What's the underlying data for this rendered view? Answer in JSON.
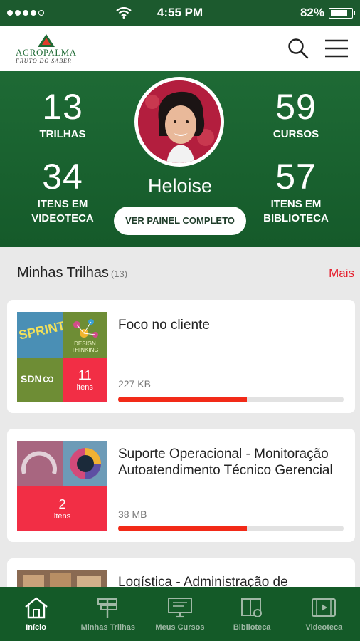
{
  "status_bar": {
    "time": "4:55 PM",
    "battery": "82%",
    "battery_level": 0.82
  },
  "header": {
    "logo_name": "AGROPALMA",
    "logo_tagline": "FRUTO DO SABER",
    "search_icon": "search-icon",
    "menu_icon": "hamburger-menu-icon"
  },
  "profile": {
    "name": "Heloise",
    "button_label": "VER PAINEL COMPLETO",
    "stats": {
      "trilhas": {
        "value": "13",
        "label": "TRILHAS"
      },
      "cursos": {
        "value": "59",
        "label": "CURSOS"
      },
      "videoteca": {
        "value": "34",
        "label_line1": "ITENS EM",
        "label_line2": "VIDEOTECA"
      },
      "biblioteca": {
        "value": "57",
        "label_line1": "ITENS EM",
        "label_line2": "BIBLIOTECA"
      }
    }
  },
  "section": {
    "title": "Minhas Trilhas",
    "count": "(13)",
    "more_label": "Mais"
  },
  "trails": [
    {
      "title": "Foco no cliente",
      "size": "227 KB",
      "items_count": "11",
      "items_label": "itens",
      "progress": 0.57,
      "thumb_text_1": "SPRINT",
      "thumb_text_2": "DESIGN THINKING",
      "thumb_text_3": "SDN"
    },
    {
      "title": "Suporte Operacional - Monitoração Autoatendimento Técnico Gerencial",
      "size": "38 MB",
      "items_count": "2",
      "items_label": "itens",
      "progress": 0.57
    },
    {
      "title": "Logística - Administração de"
    }
  ],
  "nav": [
    {
      "label": "Início",
      "icon": "home-icon",
      "active": true
    },
    {
      "label": "Minhas Trilhas",
      "icon": "signpost-icon",
      "active": false
    },
    {
      "label": "Meus Cursos",
      "icon": "monitor-icon",
      "active": false
    },
    {
      "label": "Biblioteca",
      "icon": "book-icon",
      "active": false
    },
    {
      "label": "Videoteca",
      "icon": "film-icon",
      "active": false
    }
  ],
  "colors": {
    "brand_green": "#1e6a35",
    "accent_red": "#f22e45",
    "progress_red": "#f22a18"
  }
}
